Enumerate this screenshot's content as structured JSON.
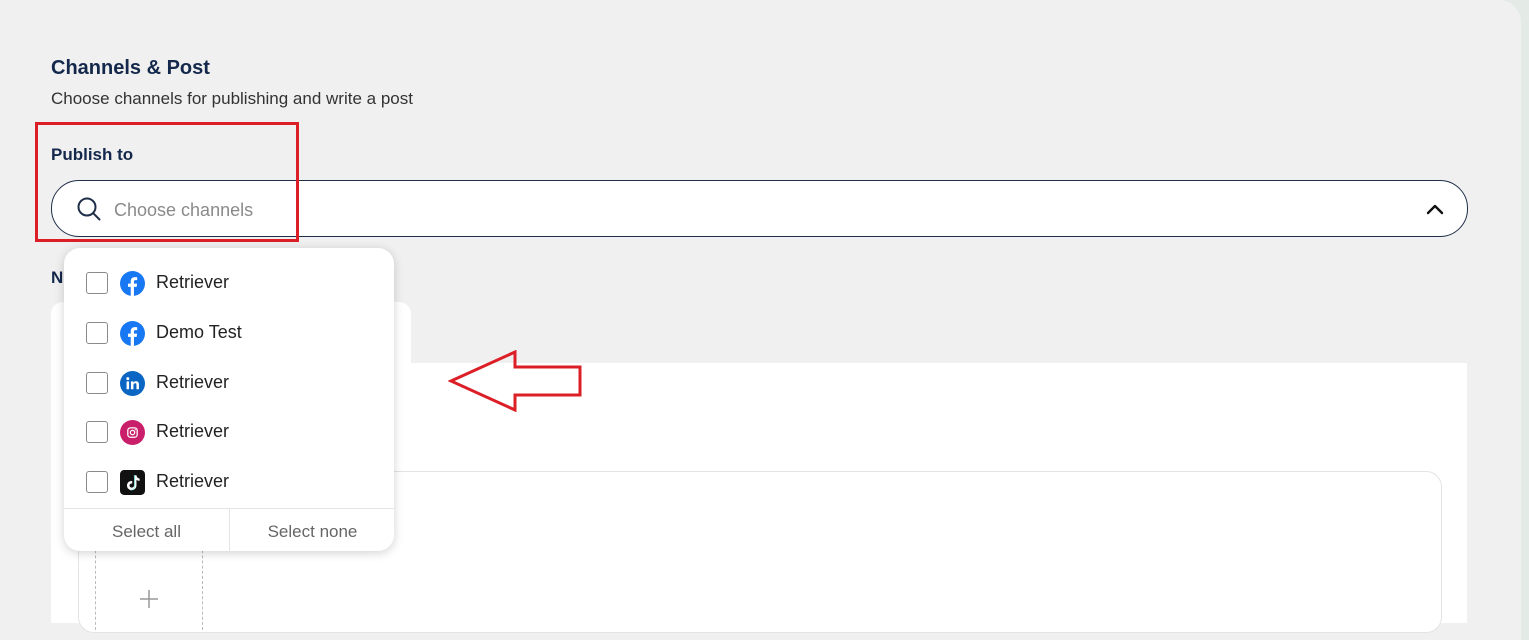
{
  "header": {
    "title": "Channels & Post",
    "subtitle": "Choose channels for publishing and write a post"
  },
  "publish": {
    "label": "Publish to",
    "placeholder": "Choose channels",
    "value": "",
    "dropdown_open": true
  },
  "partially_hidden_label": "N",
  "dropdown": {
    "options": [
      {
        "label": "Retriever",
        "network": "facebook",
        "icon": "facebook-icon",
        "checked": false
      },
      {
        "label": "Demo Test",
        "network": "facebook",
        "icon": "facebook-icon",
        "checked": false
      },
      {
        "label": "Retriever",
        "network": "linkedin",
        "icon": "linkedin-icon",
        "checked": false
      },
      {
        "label": "Retriever",
        "network": "instagram",
        "icon": "instagram-icon",
        "checked": false
      },
      {
        "label": "Retriever",
        "network": "tiktok",
        "icon": "tiktok-icon",
        "checked": false
      }
    ],
    "select_all": "Select all",
    "select_none": "Select none"
  },
  "colors": {
    "heading": "#14284b",
    "annotation_red": "#dc1f26",
    "facebook": "#1877f2",
    "linkedin": "#0a66c2",
    "instagram": "#c91f6b",
    "tiktok": "#111111"
  }
}
